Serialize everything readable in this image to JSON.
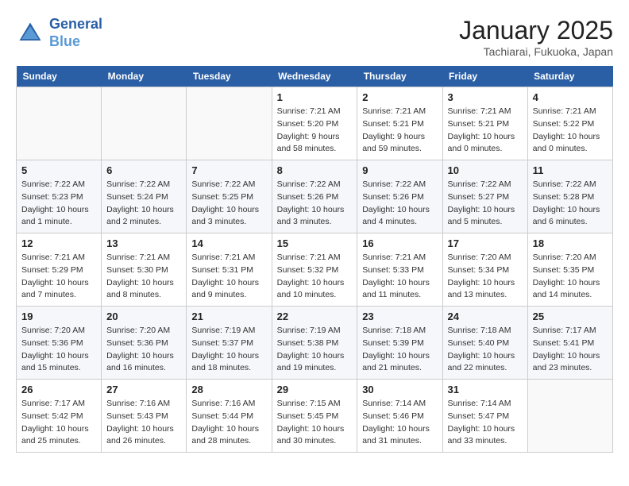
{
  "header": {
    "logo_line1": "General",
    "logo_line2": "Blue",
    "title": "January 2025",
    "subtitle": "Tachiarai, Fukuoka, Japan"
  },
  "weekdays": [
    "Sunday",
    "Monday",
    "Tuesday",
    "Wednesday",
    "Thursday",
    "Friday",
    "Saturday"
  ],
  "weeks": [
    [
      {
        "day": "",
        "detail": ""
      },
      {
        "day": "",
        "detail": ""
      },
      {
        "day": "",
        "detail": ""
      },
      {
        "day": "1",
        "detail": "Sunrise: 7:21 AM\nSunset: 5:20 PM\nDaylight: 9 hours and 58 minutes."
      },
      {
        "day": "2",
        "detail": "Sunrise: 7:21 AM\nSunset: 5:21 PM\nDaylight: 9 hours and 59 minutes."
      },
      {
        "day": "3",
        "detail": "Sunrise: 7:21 AM\nSunset: 5:21 PM\nDaylight: 10 hours and 0 minutes."
      },
      {
        "day": "4",
        "detail": "Sunrise: 7:21 AM\nSunset: 5:22 PM\nDaylight: 10 hours and 0 minutes."
      }
    ],
    [
      {
        "day": "5",
        "detail": "Sunrise: 7:22 AM\nSunset: 5:23 PM\nDaylight: 10 hours and 1 minute."
      },
      {
        "day": "6",
        "detail": "Sunrise: 7:22 AM\nSunset: 5:24 PM\nDaylight: 10 hours and 2 minutes."
      },
      {
        "day": "7",
        "detail": "Sunrise: 7:22 AM\nSunset: 5:25 PM\nDaylight: 10 hours and 3 minutes."
      },
      {
        "day": "8",
        "detail": "Sunrise: 7:22 AM\nSunset: 5:26 PM\nDaylight: 10 hours and 3 minutes."
      },
      {
        "day": "9",
        "detail": "Sunrise: 7:22 AM\nSunset: 5:26 PM\nDaylight: 10 hours and 4 minutes."
      },
      {
        "day": "10",
        "detail": "Sunrise: 7:22 AM\nSunset: 5:27 PM\nDaylight: 10 hours and 5 minutes."
      },
      {
        "day": "11",
        "detail": "Sunrise: 7:22 AM\nSunset: 5:28 PM\nDaylight: 10 hours and 6 minutes."
      }
    ],
    [
      {
        "day": "12",
        "detail": "Sunrise: 7:21 AM\nSunset: 5:29 PM\nDaylight: 10 hours and 7 minutes."
      },
      {
        "day": "13",
        "detail": "Sunrise: 7:21 AM\nSunset: 5:30 PM\nDaylight: 10 hours and 8 minutes."
      },
      {
        "day": "14",
        "detail": "Sunrise: 7:21 AM\nSunset: 5:31 PM\nDaylight: 10 hours and 9 minutes."
      },
      {
        "day": "15",
        "detail": "Sunrise: 7:21 AM\nSunset: 5:32 PM\nDaylight: 10 hours and 10 minutes."
      },
      {
        "day": "16",
        "detail": "Sunrise: 7:21 AM\nSunset: 5:33 PM\nDaylight: 10 hours and 11 minutes."
      },
      {
        "day": "17",
        "detail": "Sunrise: 7:20 AM\nSunset: 5:34 PM\nDaylight: 10 hours and 13 minutes."
      },
      {
        "day": "18",
        "detail": "Sunrise: 7:20 AM\nSunset: 5:35 PM\nDaylight: 10 hours and 14 minutes."
      }
    ],
    [
      {
        "day": "19",
        "detail": "Sunrise: 7:20 AM\nSunset: 5:36 PM\nDaylight: 10 hours and 15 minutes."
      },
      {
        "day": "20",
        "detail": "Sunrise: 7:20 AM\nSunset: 5:36 PM\nDaylight: 10 hours and 16 minutes."
      },
      {
        "day": "21",
        "detail": "Sunrise: 7:19 AM\nSunset: 5:37 PM\nDaylight: 10 hours and 18 minutes."
      },
      {
        "day": "22",
        "detail": "Sunrise: 7:19 AM\nSunset: 5:38 PM\nDaylight: 10 hours and 19 minutes."
      },
      {
        "day": "23",
        "detail": "Sunrise: 7:18 AM\nSunset: 5:39 PM\nDaylight: 10 hours and 21 minutes."
      },
      {
        "day": "24",
        "detail": "Sunrise: 7:18 AM\nSunset: 5:40 PM\nDaylight: 10 hours and 22 minutes."
      },
      {
        "day": "25",
        "detail": "Sunrise: 7:17 AM\nSunset: 5:41 PM\nDaylight: 10 hours and 23 minutes."
      }
    ],
    [
      {
        "day": "26",
        "detail": "Sunrise: 7:17 AM\nSunset: 5:42 PM\nDaylight: 10 hours and 25 minutes."
      },
      {
        "day": "27",
        "detail": "Sunrise: 7:16 AM\nSunset: 5:43 PM\nDaylight: 10 hours and 26 minutes."
      },
      {
        "day": "28",
        "detail": "Sunrise: 7:16 AM\nSunset: 5:44 PM\nDaylight: 10 hours and 28 minutes."
      },
      {
        "day": "29",
        "detail": "Sunrise: 7:15 AM\nSunset: 5:45 PM\nDaylight: 10 hours and 30 minutes."
      },
      {
        "day": "30",
        "detail": "Sunrise: 7:14 AM\nSunset: 5:46 PM\nDaylight: 10 hours and 31 minutes."
      },
      {
        "day": "31",
        "detail": "Sunrise: 7:14 AM\nSunset: 5:47 PM\nDaylight: 10 hours and 33 minutes."
      },
      {
        "day": "",
        "detail": ""
      }
    ]
  ]
}
